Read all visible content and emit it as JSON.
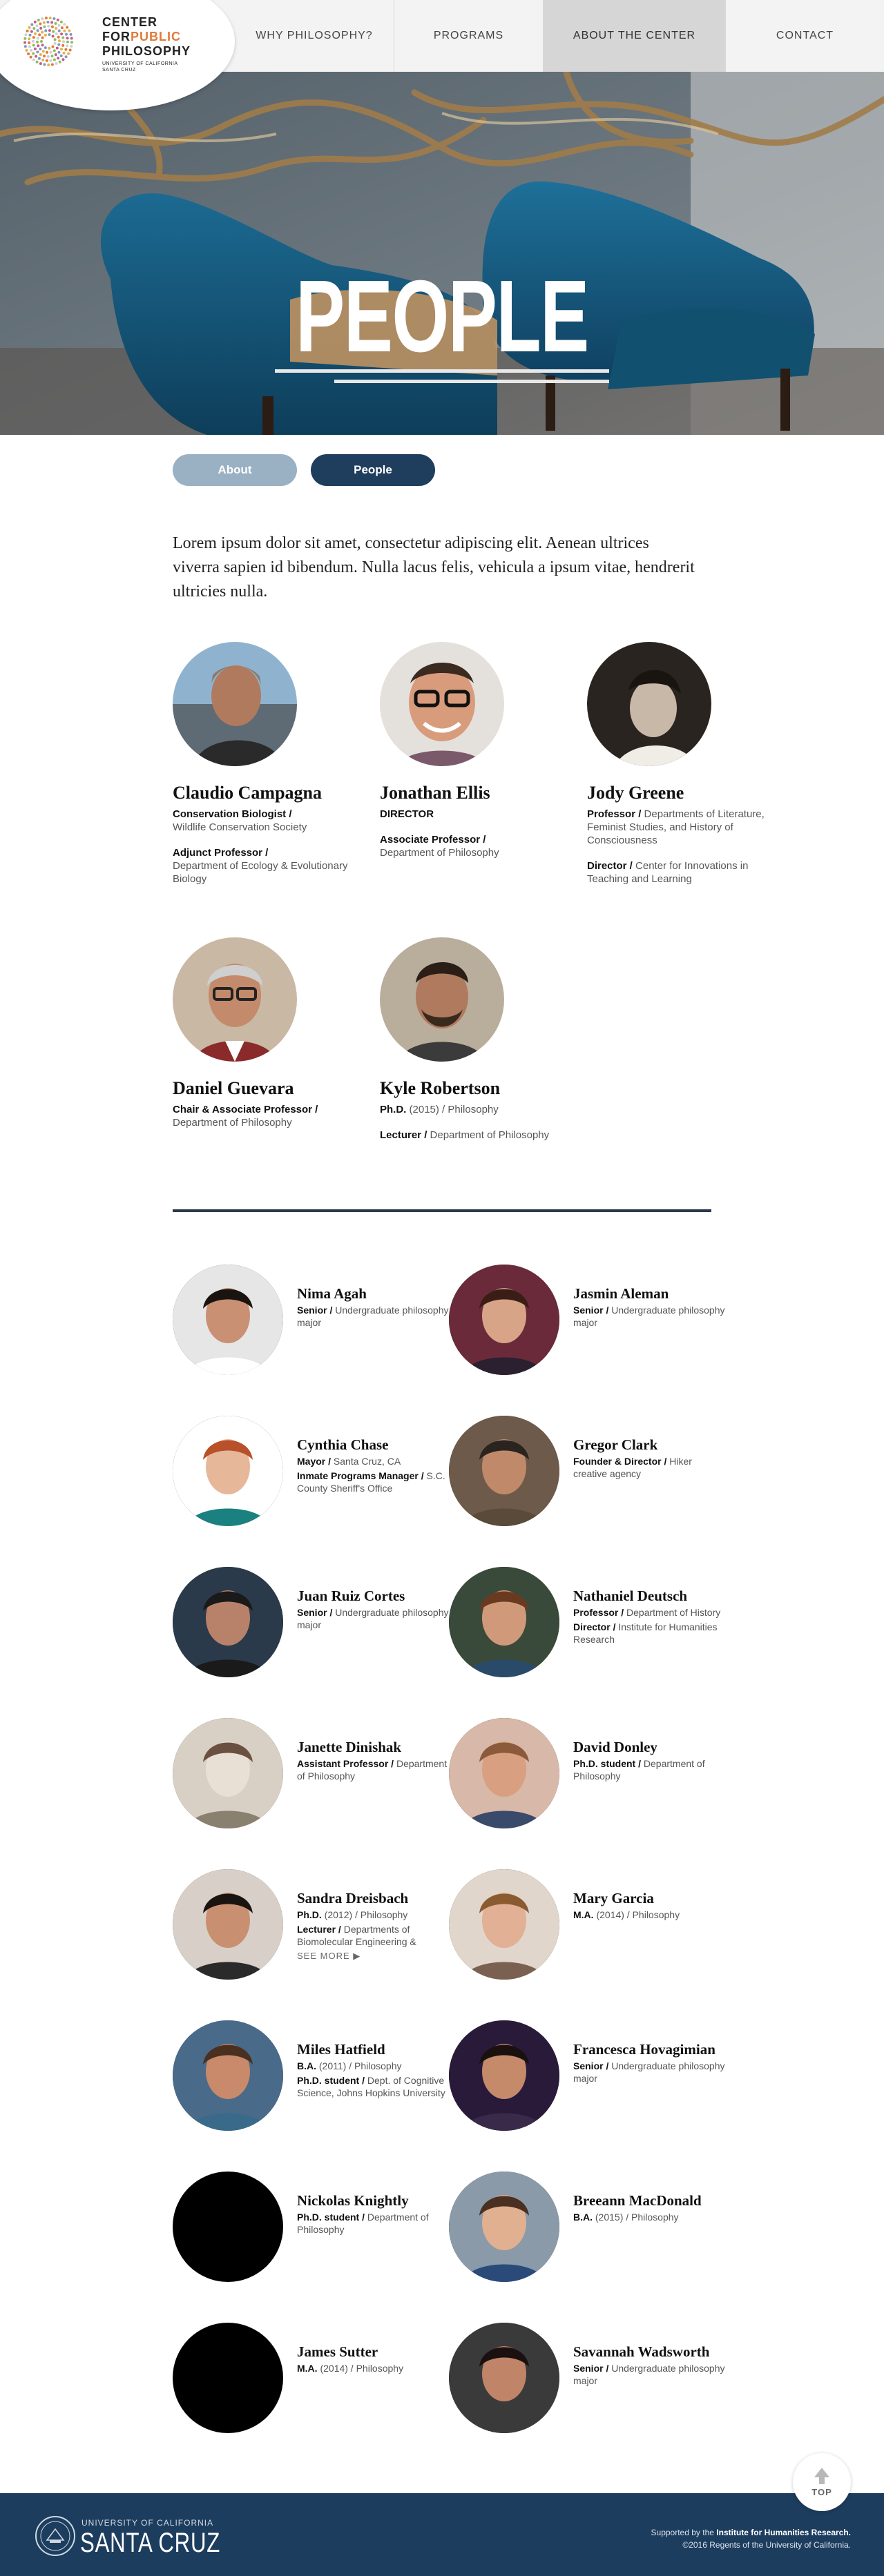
{
  "header": {
    "logo": {
      "line1": "CENTER",
      "line2_a": "FOR",
      "line2_b": "PUBLIC",
      "line3": "PHILOSOPHY",
      "sub1": "UNIVERSITY OF CALIFORNIA",
      "sub2": "SANTA CRUZ"
    },
    "nav": [
      {
        "label": "WHY PHILOSOPHY?",
        "active": false
      },
      {
        "label": "PROGRAMS",
        "active": false
      },
      {
        "label": "ABOUT THE CENTER",
        "active": true
      },
      {
        "label": "CONTACT",
        "active": false
      }
    ]
  },
  "hero": {
    "title": "PEOPLE"
  },
  "tabs": {
    "about": "About",
    "people": "People"
  },
  "intro": "Lorem ipsum dolor sit amet, consectetur adipiscing elit. Aenean ultrices viverra sapien id bibendum. Nulla lacus felis, vehicula a ipsum vitae, hendrerit ultricies nulla.",
  "featured": [
    {
      "name": "Claudio Campagna",
      "r1a": "Conservation Biologist /",
      "r1b": "Wildlife Conservation Society",
      "r2a": "Adjunct Professor /",
      "r2b": "Department of Ecology & Evolutionary Biology",
      "r3a": "",
      "r3b": ""
    },
    {
      "name": "Jonathan Ellis",
      "r1a": "DIRECTOR",
      "r1b": "",
      "r2a": "Associate Professor /",
      "r2b": "Department of Philosophy",
      "r3a": "",
      "r3b": ""
    },
    {
      "name": "Jody Greene",
      "r1a": "Professor /",
      "r1b": "Departments of Literature, Feminist Studies, and History of Consciousness",
      "r2a": "Director /",
      "r2b": "Center for Innovations in Teaching and Learning",
      "r3a": "",
      "r3b": ""
    },
    {
      "name": "Daniel Guevara",
      "r1a": "Chair & Associate Professor /",
      "r1b": "Department of Philosophy",
      "r2a": "",
      "r2b": "",
      "r3a": "",
      "r3b": ""
    },
    {
      "name": "Kyle Robertson",
      "r1a": "Ph.D.",
      "r1b": "(2015) / Philosophy",
      "r2a": "Lecturer /",
      "r2b": "Department of Philosophy",
      "r3a": "",
      "r3b": ""
    }
  ],
  "people": [
    {
      "name": "Nima Agah",
      "l1b": "Senior /",
      "l1": "Undergraduate philosophy major",
      "l2b": "",
      "l2": "",
      "photo": true
    },
    {
      "name": "Jasmin Aleman",
      "l1b": "Senior /",
      "l1": "Undergraduate philosophy major",
      "l2b": "",
      "l2": "",
      "photo": true
    },
    {
      "name": "Cynthia Chase",
      "l1b": "Mayor /",
      "l1": "Santa Cruz, CA",
      "l2b": "Inmate Programs Manager /",
      "l2": "S.C. County Sheriff's Office",
      "photo": true
    },
    {
      "name": "Gregor Clark",
      "l1b": "Founder & Director /",
      "l1": "Hiker creative agency",
      "l2b": "",
      "l2": "",
      "photo": true
    },
    {
      "name": "Juan Ruiz Cortes",
      "l1b": "Senior /",
      "l1": "Undergraduate philosophy major",
      "l2b": "",
      "l2": "",
      "photo": true
    },
    {
      "name": "Nathaniel Deutsch",
      "l1b": "Professor /",
      "l1": "Department of History",
      "l2b": "Director /",
      "l2": "Institute for Humanities Research",
      "photo": true
    },
    {
      "name": "Janette Dinishak",
      "l1b": "Assistant Professor /",
      "l1": "Department of Philosophy",
      "l2b": "",
      "l2": "",
      "photo": true
    },
    {
      "name": "David Donley",
      "l1b": "Ph.D. student /",
      "l1": "Department of Philosophy",
      "l2b": "",
      "l2": "",
      "photo": true
    },
    {
      "name": "Sandra Dreisbach",
      "l1b": "Ph.D.",
      "l1": "(2012) / Philosophy",
      "l2b": "Lecturer /",
      "l2": "Departments of Biomolecular Engineering &",
      "photo": true,
      "see_more": "SEE MORE ▶"
    },
    {
      "name": "Mary Garcia",
      "l1b": "M.A.",
      "l1": "(2014) / Philosophy",
      "l2b": "",
      "l2": "",
      "photo": true
    },
    {
      "name": "Miles Hatfield",
      "l1b": "B.A.",
      "l1": "(2011) / Philosophy",
      "l2b": "Ph.D. student /",
      "l2": "Dept. of Cognitive Science, Johns Hopkins University",
      "photo": true
    },
    {
      "name": "Francesca Hovagimian",
      "l1b": "Senior /",
      "l1": "Undergraduate philosophy major",
      "l2b": "",
      "l2": "",
      "photo": true
    },
    {
      "name": "Nickolas Knightly",
      "l1b": "Ph.D. student /",
      "l1": "Department of Philosophy",
      "l2b": "",
      "l2": "",
      "photo": false
    },
    {
      "name": "Breeann MacDonald",
      "l1b": "B.A.",
      "l1": "(2015) / Philosophy",
      "l2b": "",
      "l2": "",
      "photo": true
    },
    {
      "name": "James Sutter",
      "l1b": "M.A.",
      "l1": "(2014) / Philosophy",
      "l2b": "",
      "l2": "",
      "photo": false
    },
    {
      "name": "Savannah Wadsworth",
      "l1b": "Senior /",
      "l1": "Undergraduate philosophy major",
      "l2b": "",
      "l2": "",
      "photo": true
    }
  ],
  "footer": {
    "uc_small": "UNIVERSITY OF CALIFORNIA",
    "uc_big": "SANTA CRUZ",
    "credit1a": "Supported by the",
    "credit1b": "Institute for Humanities Research.",
    "credit2": "©2016 Regents of the University of California."
  },
  "top_button": "TOP",
  "colors": {
    "navy": "#1f3d5c",
    "light_blue": "#9ab0c3",
    "accent_orange": "#e07a3a",
    "footer": "#1d3d5e"
  }
}
